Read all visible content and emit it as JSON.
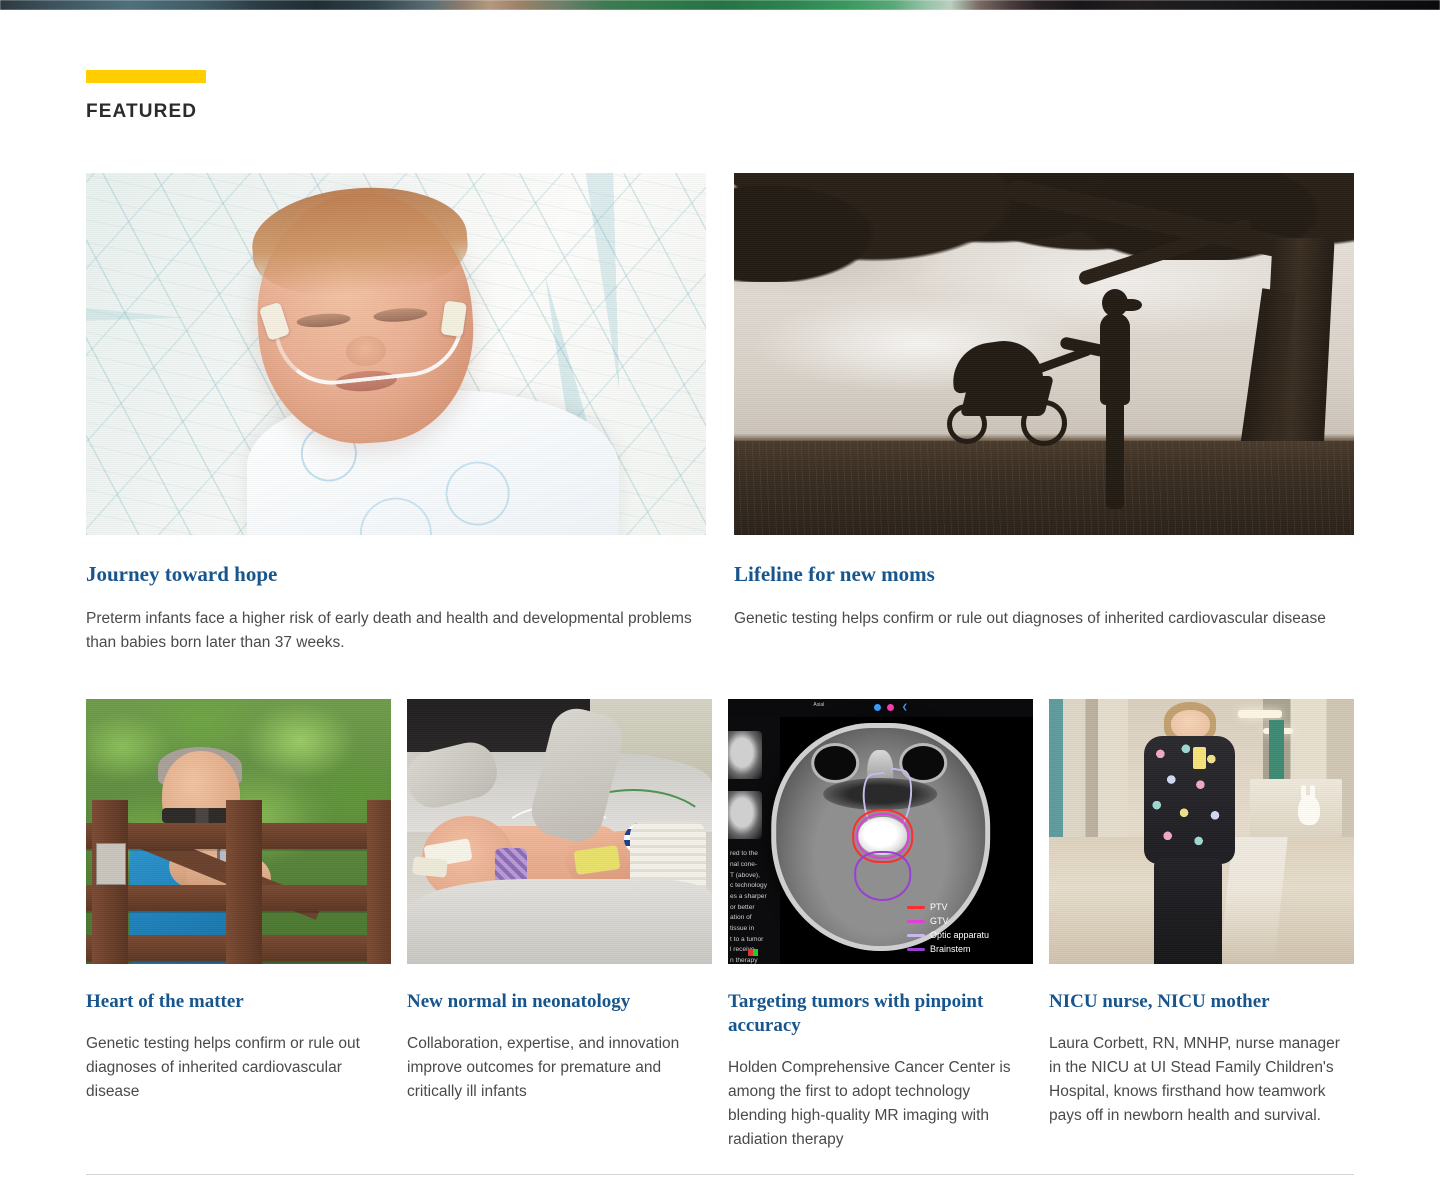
{
  "section": {
    "eyebrow_rule_color": "#FFCD00",
    "title": "FEATURED"
  },
  "theme": {
    "headline_color": "#17558C",
    "accent_yellow": "#FFCD00",
    "body_text_color": "#4a4a4a",
    "divider_color": "#d4d4d4"
  },
  "featured_cards": [
    {
      "image_name": "swaddled-preterm-infant-on-quilt",
      "title": "Journey toward hope",
      "description": "Preterm infants face a higher risk of early death and health and developmental problems than babies born later than 37 weeks."
    },
    {
      "image_name": "silhouette-mother-with-stroller-under-tree",
      "title": "Lifeline for new moms",
      "description": "Genetic testing helps confirm or rule out diagnoses of inherited cardiovascular disease"
    }
  ],
  "secondary_cards": [
    {
      "image_name": "man-in-blue-shirt-leaning-on-wooden-fence",
      "title": "Heart of the matter",
      "description": "Genetic testing helps confirm or rule out diagnoses of inherited cardiovascular disease"
    },
    {
      "image_name": "premature-infant-in-nicu-with-gloved-hands",
      "title": "New normal in neonatology",
      "description": "Collaboration, expertise, and innovation improve outcomes for premature and critically ill infants"
    },
    {
      "image_name": "mri-brain-scan-radiation-treatment-plan",
      "title": "Targeting tumors with pinpoint accuracy",
      "description": "Holden Comprehensive Cancer Center is among the first to adopt technology blending high-quality MR imaging with radiation therapy"
    },
    {
      "image_name": "nurse-in-hospital-hallway",
      "title": "NICU nurse, NICU mother",
      "description": "Laura Corbett, RN, MNHP, nurse manager in the NICU at UI Stead Family Children's Hospital, knows firsthand how teamwork pays off in newborn health and survival."
    }
  ],
  "mri_overlay": {
    "view_label": "Axial",
    "caption_fragment": "red to the\nnal cone-\nT (above),\nc technology\nes a sharper\nor better\nation of\ntissue in\nt to a tumor\nl receive\nn therapy\nred).",
    "legend": [
      {
        "label": "PTV",
        "color": "#ff2d2d"
      },
      {
        "label": "GTV",
        "color": "#e040d8"
      },
      {
        "label": "Optic apparatu",
        "color": "#c7b9ee"
      },
      {
        "label": "Brainstem",
        "color": "#9a3fd4"
      }
    ]
  }
}
